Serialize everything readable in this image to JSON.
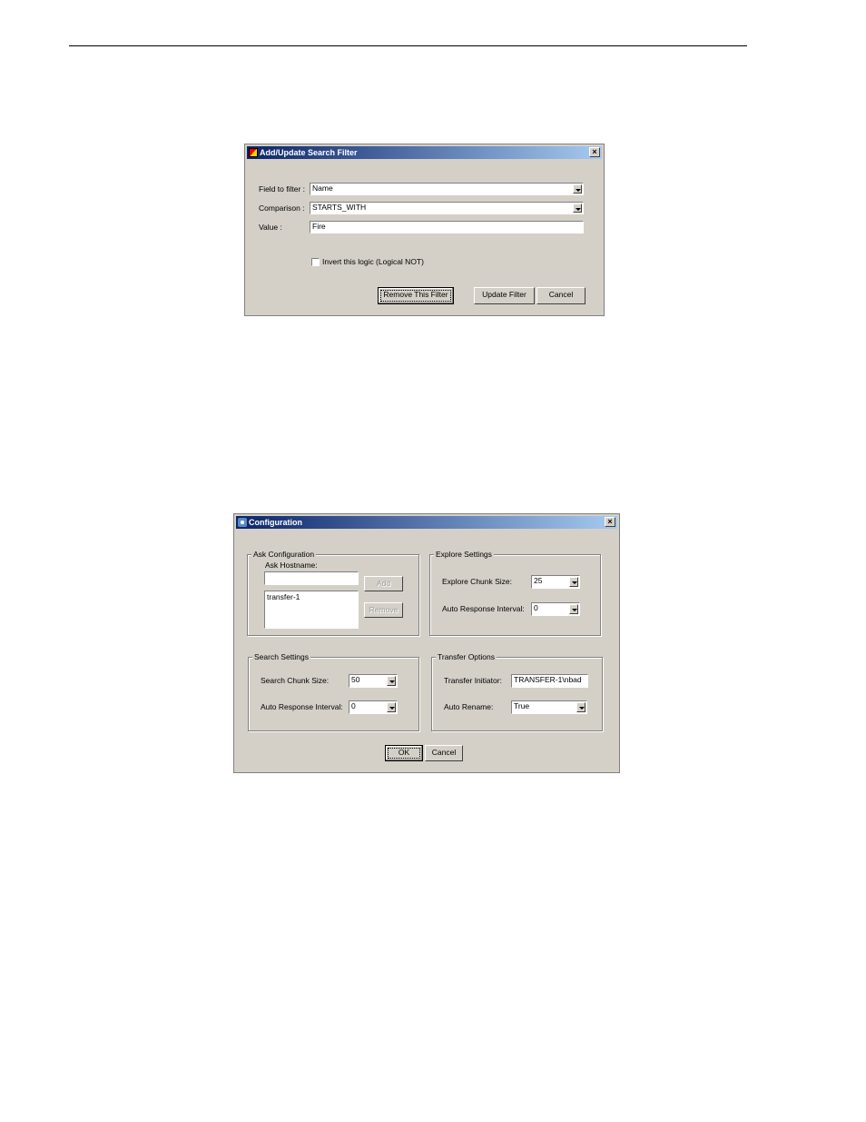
{
  "filter_dialog": {
    "title": "Add/Update Search Filter",
    "field_label": "Field to filter :",
    "field_value": "Name",
    "comparison_label": "Comparison :",
    "comparison_value": "STARTS_WITH",
    "value_label": "Value :",
    "value_value": "Fire",
    "invert_label": "Invert this logic (Logical NOT)",
    "remove_button": "Remove This Filter",
    "update_button": "Update Filter",
    "cancel_button": "Cancel"
  },
  "config_dialog": {
    "title": "Configuration",
    "ask_group": {
      "title": "Ask Configuration",
      "hostname_label": "Ask Hostname:",
      "hostname_value": "",
      "hosts": [
        "transfer-1"
      ],
      "add_button": "Add",
      "remove_button": "Remove"
    },
    "explore_group": {
      "title": "Explore Settings",
      "chunk_label": "Explore Chunk Size:",
      "chunk_value": "25",
      "interval_label": "Auto Response Interval:",
      "interval_value": "0"
    },
    "search_group": {
      "title": "Search Settings",
      "chunk_label": "Search Chunk Size:",
      "chunk_value": "50",
      "interval_label": "Auto Response Interval:",
      "interval_value": "0"
    },
    "transfer_group": {
      "title": "Transfer Options",
      "initiator_label": "Transfer Initiator:",
      "initiator_value": "TRANSFER-1\\nbad",
      "rename_label": "Auto Rename:",
      "rename_value": "True"
    },
    "ok_button": "OK",
    "cancel_button": "Cancel"
  }
}
